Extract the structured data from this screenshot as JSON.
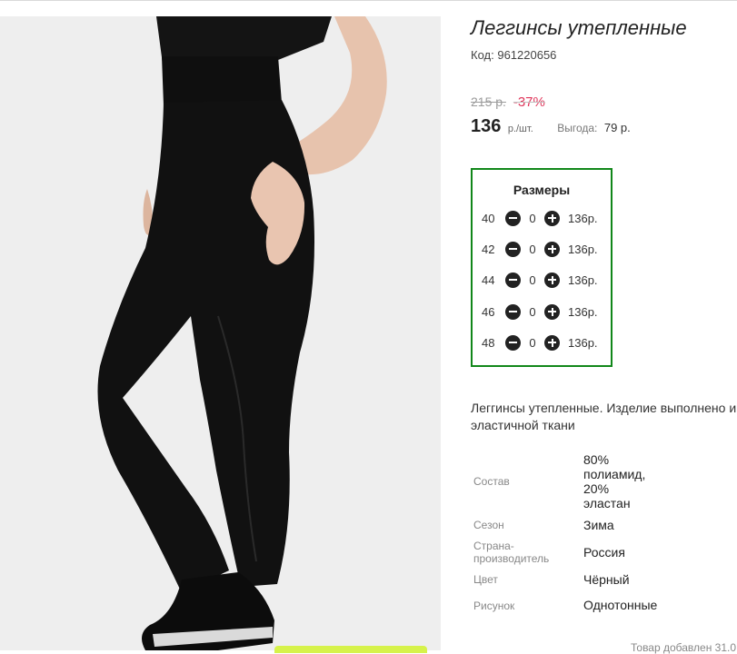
{
  "product": {
    "title": "Леггинсы утепленные",
    "code_label": "Код:",
    "code": "961220656"
  },
  "price": {
    "old": "215 р.",
    "discount": "-37%",
    "current": "136",
    "unit": "р./шт.",
    "saving_label": "Выгода:",
    "saving_value": "79 р."
  },
  "sizes": {
    "title": "Размеры",
    "rows": [
      {
        "size": "40",
        "qty": "0",
        "price": "136р."
      },
      {
        "size": "42",
        "qty": "0",
        "price": "136р."
      },
      {
        "size": "44",
        "qty": "0",
        "price": "136р."
      },
      {
        "size": "46",
        "qty": "0",
        "price": "136р."
      },
      {
        "size": "48",
        "qty": "0",
        "price": "136р."
      }
    ]
  },
  "description": {
    "line1": "Леггинсы утепленные. Изделие выполнено и",
    "line2": "эластичной ткани"
  },
  "specs": {
    "composition": {
      "label": "Состав",
      "value": [
        "80%",
        "полиамид,",
        "20%",
        "эластан"
      ]
    },
    "season": {
      "label": "Сезон",
      "value": "Зима"
    },
    "country": {
      "label": [
        "Страна-",
        "производитель"
      ],
      "value": "Россия"
    },
    "color": {
      "label": "Цвет",
      "value": "Чёрный"
    },
    "pattern": {
      "label": "Рисунок",
      "value": "Однотонные"
    }
  },
  "footer": {
    "added_note": "Товар добавлен 31.0"
  },
  "colors": {
    "sizes_border": "#11871a",
    "discount": "#e0355a",
    "add_bar": "#d6f24a"
  },
  "icons": {
    "decrease": "minus-circle-icon",
    "increase": "plus-circle-icon"
  }
}
